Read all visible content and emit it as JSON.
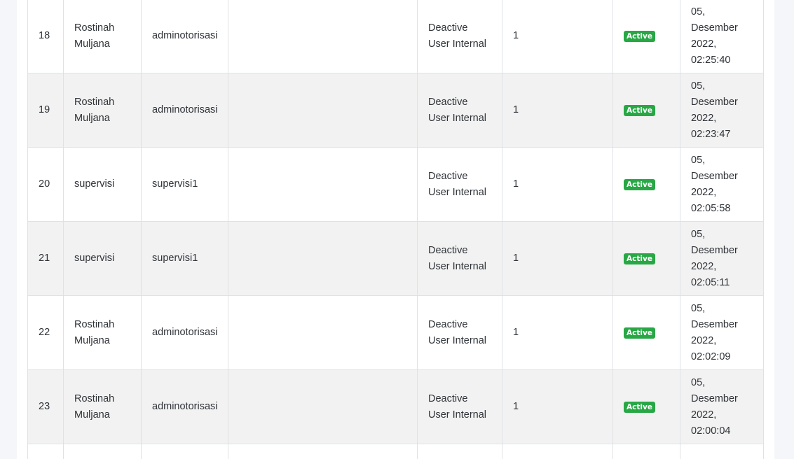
{
  "table": {
    "rows": [
      {
        "no": "18",
        "name": "Rostinah Muljana",
        "username": "adminotorisasi",
        "description": "",
        "activity": "Deactive User Internal",
        "count": "1",
        "status": "Active",
        "datetime": "05, Desember 2022, 02:25:40"
      },
      {
        "no": "19",
        "name": "Rostinah Muljana",
        "username": "adminotorisasi",
        "description": "",
        "activity": "Deactive User Internal",
        "count": "1",
        "status": "Active",
        "datetime": "05, Desember 2022, 02:23:47"
      },
      {
        "no": "20",
        "name": "supervisi",
        "username": "supervisi1",
        "description": "",
        "activity": "Deactive User Internal",
        "count": "1",
        "status": "Active",
        "datetime": "05, Desember 2022, 02:05:58"
      },
      {
        "no": "21",
        "name": "supervisi",
        "username": "supervisi1",
        "description": "",
        "activity": "Deactive User Internal",
        "count": "1",
        "status": "Active",
        "datetime": "05, Desember 2022, 02:05:11"
      },
      {
        "no": "22",
        "name": "Rostinah Muljana",
        "username": "adminotorisasi",
        "description": "",
        "activity": "Deactive User Internal",
        "count": "1",
        "status": "Active",
        "datetime": "05, Desember 2022, 02:02:09"
      },
      {
        "no": "23",
        "name": "Rostinah Muljana",
        "username": "adminotorisasi",
        "description": "",
        "activity": "Deactive User Internal",
        "count": "1",
        "status": "Active",
        "datetime": "05, Desember 2022, 02:00:04"
      }
    ]
  },
  "colors": {
    "page_bg": "#f4f6f9",
    "stripe": "#f2f2f2",
    "border": "#dee2e6",
    "badge_success": "#28a745"
  }
}
